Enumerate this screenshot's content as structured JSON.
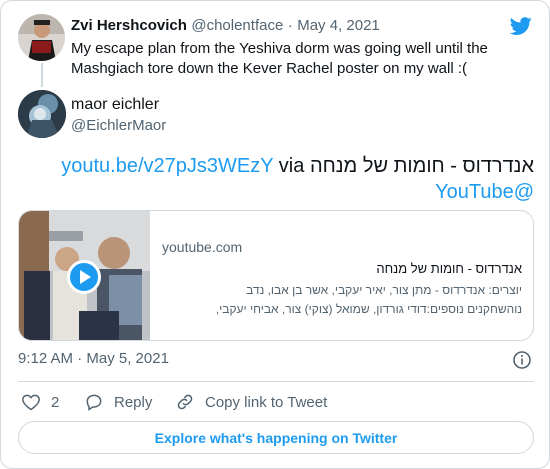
{
  "parent_tweet": {
    "author_name": "Zvi Hershcovich",
    "handle": "@cholentface",
    "separator": "·",
    "date": "May 4, 2021",
    "text": "My escape plan from the Yeshiva dorm was going well until the Mashgiach tore down the Kever Rachel poster on my wall :("
  },
  "tweet": {
    "author_name": "maor eichler",
    "handle": "@EichlerMaor",
    "text_prefix": "אנדרדוס - חומות של מנחה",
    "link_text": "youtu.be/v27pJs3WEzY",
    "via": "via",
    "mention": "@YouTube",
    "timestamp": "9:12 AM · May 5, 2021"
  },
  "media_card": {
    "domain": "youtube.com",
    "title": "אנדרדוס - חומות של מנחה",
    "description_line1": "יוצרים: אנדרדוס - מתן צור, יאיר יעקבי, אשר בן אבו, נדב",
    "description_line2": "נוהשחקנים נוספים:דודי גורדון, שמואל (צוקי) צור, אביחי יעקבי,"
  },
  "actions": {
    "like_count": "2",
    "reply_label": "Reply",
    "copy_label": "Copy link to Tweet"
  },
  "explore_label": "Explore what's happening on Twitter",
  "colors": {
    "accent": "#1d9bf0",
    "text": "#0f1419",
    "muted": "#536471",
    "border": "#cfd9de"
  }
}
